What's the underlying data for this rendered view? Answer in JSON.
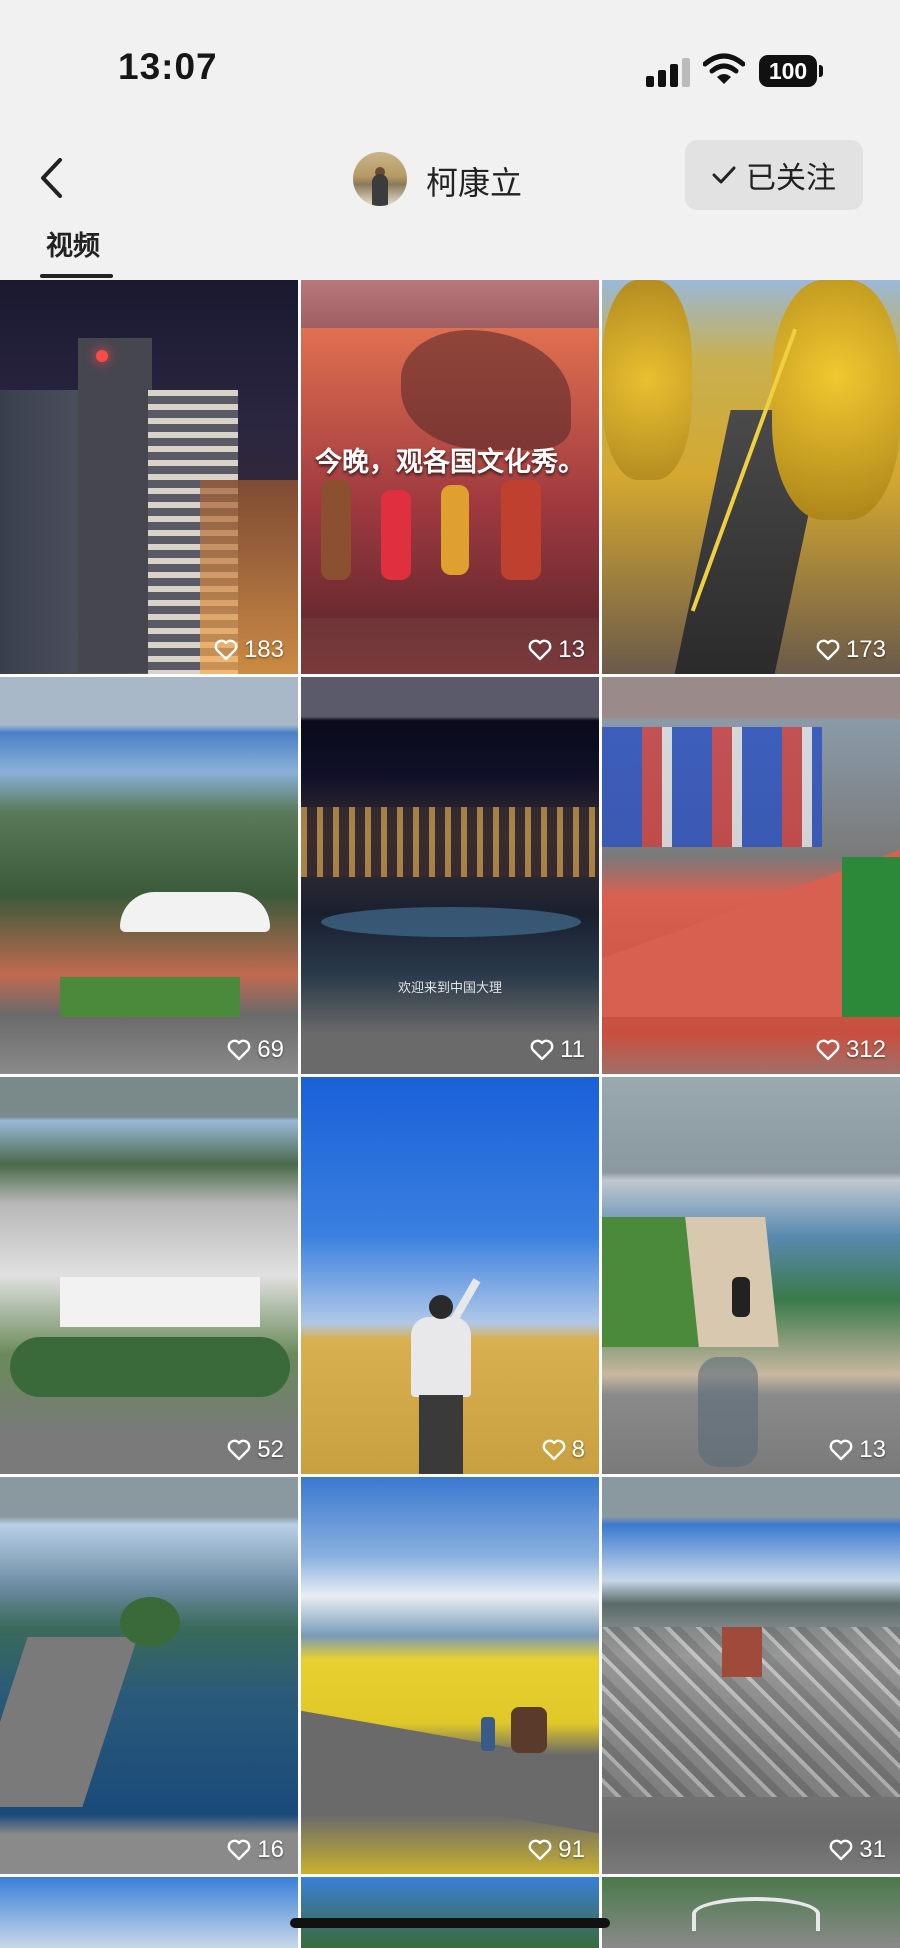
{
  "status_bar": {
    "time": "13:07",
    "battery": "100"
  },
  "header": {
    "back_icon": "chevron-left-icon",
    "profile_name": "柯康立",
    "follow_label": "已关注",
    "follow_icon": "checkmark-icon"
  },
  "tabs": [
    {
      "label": "视频",
      "active": true
    }
  ],
  "videos": [
    {
      "likes": "183",
      "scene": "city-night-skyscraper"
    },
    {
      "likes": "13",
      "scene": "stage-performance",
      "caption": "今晚，观各国文化秀。"
    },
    {
      "likes": "173",
      "scene": "ginkgo-avenue"
    },
    {
      "likes": "69",
      "scene": "campus-stadium-aerial"
    },
    {
      "likes": "11",
      "scene": "city-night-river",
      "caption": "欢迎来到中国大理"
    },
    {
      "likes": "312",
      "scene": "running-track-event"
    },
    {
      "likes": "52",
      "scene": "campus-buildings-aerial"
    },
    {
      "likes": "8",
      "scene": "rice-field-drone"
    },
    {
      "likes": "13",
      "scene": "lakeside-cycling"
    },
    {
      "likes": "16",
      "scene": "lake-pier"
    },
    {
      "likes": "91",
      "scene": "rapeseed-road-horse"
    },
    {
      "likes": "31",
      "scene": "old-town-aerial"
    }
  ],
  "colors": {
    "header_bg": "#f1f1f1",
    "follow_bg": "#e2e2e2"
  }
}
